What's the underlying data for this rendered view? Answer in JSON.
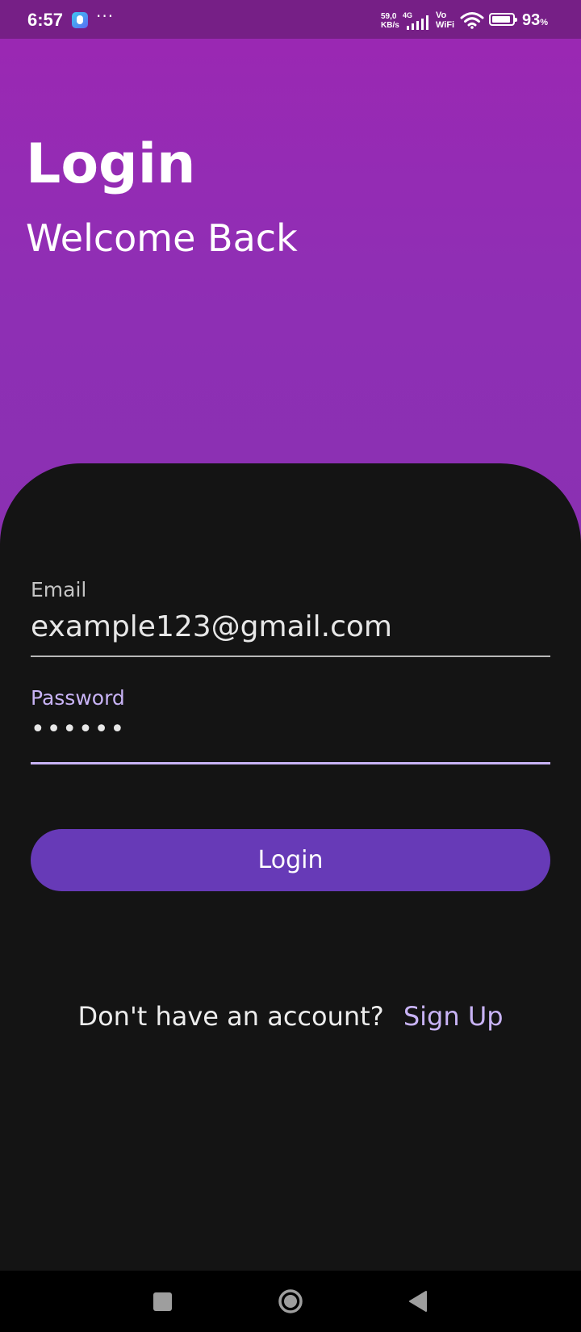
{
  "status_bar": {
    "time": "6:57",
    "dots": "···",
    "net_speed_value": "59,0",
    "net_speed_unit": "KB/s",
    "net_type": "4G",
    "vowifi_top": "Vo",
    "vowifi_bottom": "WiFi",
    "battery_percent": "93",
    "battery_unit": "%",
    "battery_level": 0.93
  },
  "header": {
    "title": "Login",
    "subtitle": "Welcome Back"
  },
  "form": {
    "email": {
      "label": "Email",
      "value": "example123@gmail.com"
    },
    "password": {
      "label": "Password",
      "masked_value": "••••••"
    },
    "login_button_label": "Login"
  },
  "signup": {
    "prompt": "Don't have an account?",
    "link_label": "Sign Up"
  },
  "colors": {
    "header_gradient_top": "#9c27b3",
    "header_gradient_bottom": "#8a30b2",
    "status_bar": "#761f86",
    "card_background": "#141414",
    "accent": "#673ab7",
    "accent_light": "#c8b3f5"
  },
  "icons": {
    "signal": "signal-icon",
    "wifi": "wifi-icon",
    "battery": "battery-icon",
    "nav_recent": "square-icon",
    "nav_home": "circle-icon",
    "nav_back": "triangle-back-icon"
  }
}
